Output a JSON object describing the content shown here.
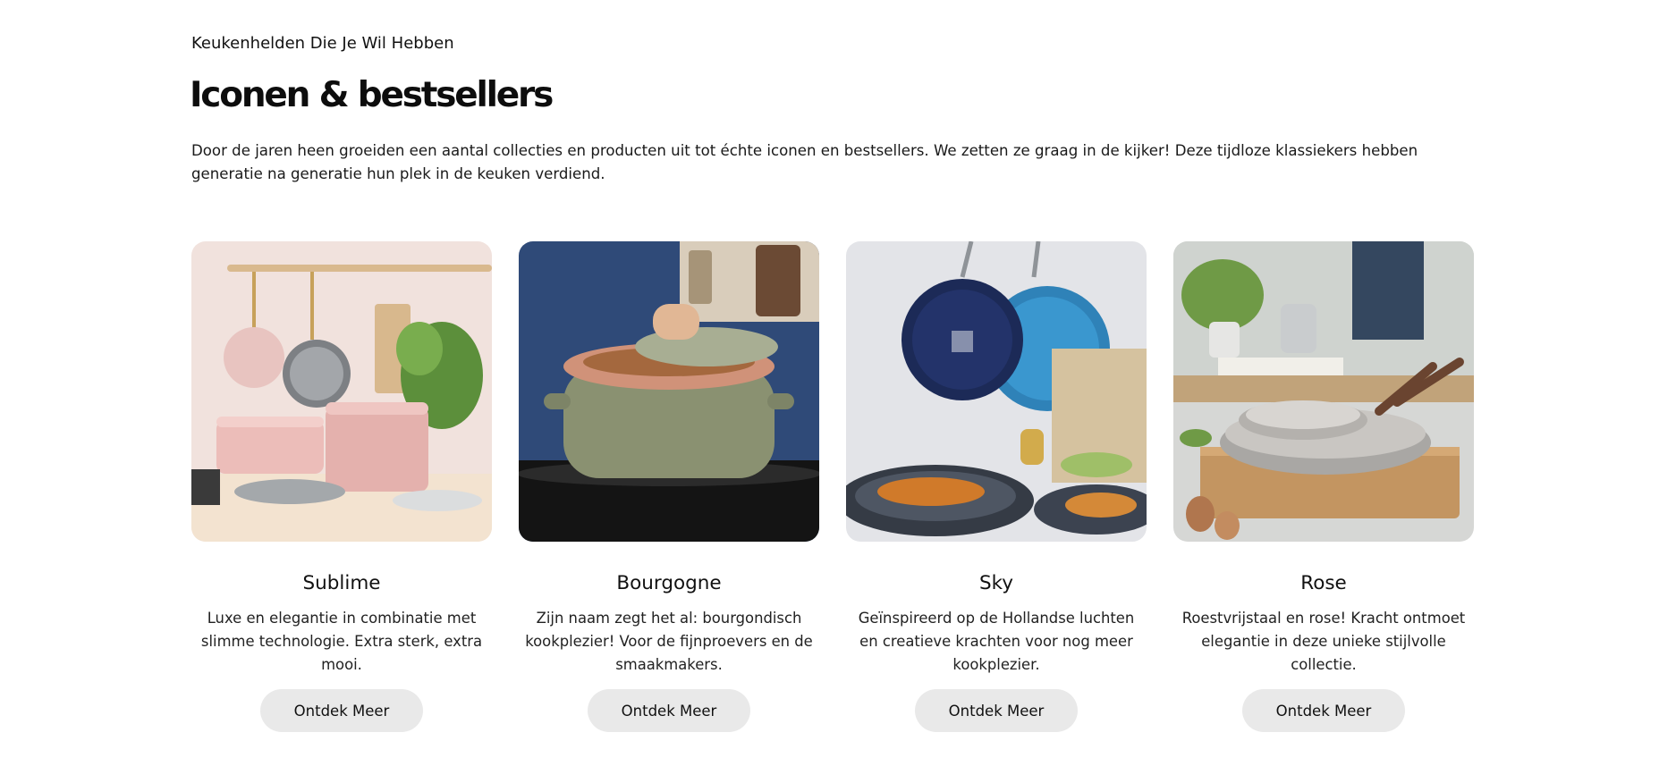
{
  "section": {
    "eyebrow": "Keukenhelden Die Je Wil Hebben",
    "title": "Iconen & bestsellers",
    "intro": "Door de jaren heen groeiden een aantal collecties en producten uit tot échte iconen en bestsellers. We zetten ze graag in de kijker! Deze tijdloze klassiekers hebben generatie na generatie hun plek in de keuken verdiend."
  },
  "cards": [
    {
      "title": "Sublime",
      "text": "Luxe en elegantie in combinatie met slimme technologie. Extra sterk, extra mooi.",
      "button": "Ontdek Meer"
    },
    {
      "title": "Bourgogne",
      "text": "Zijn naam zegt het al: bourgondisch kookplezier! Voor de fijnproevers en de smaakmakers.",
      "button": "Ontdek Meer"
    },
    {
      "title": "Sky",
      "text": "Geïnspireerd op de Hollandse luchten en creatieve krachten voor nog meer kookplezier.",
      "button": "Ontdek Meer"
    },
    {
      "title": "Rose",
      "text": "Roestvrijstaal en rose! Kracht ontmoet elegantie in deze unieke stijlvolle collectie.",
      "button": "Ontdek Meer"
    }
  ],
  "colors": {
    "button_bg": "#e9e9e9",
    "text": "#111111",
    "background": "#ffffff"
  }
}
